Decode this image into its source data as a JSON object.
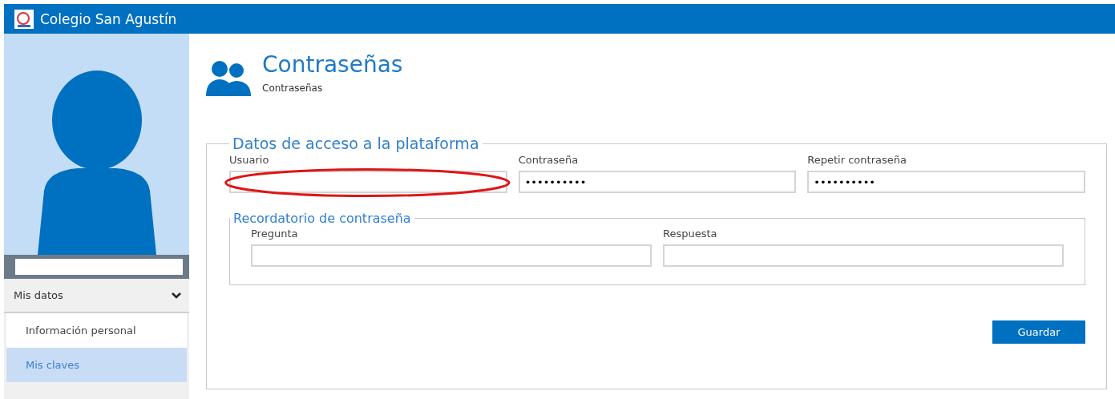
{
  "header": {
    "title": "Colegio San Agustín"
  },
  "sidebar": {
    "menu": {
      "label": "Mis datos",
      "expanded": true
    },
    "items": [
      {
        "label": "Información personal",
        "selected": false
      },
      {
        "label": "Mis claves",
        "selected": true
      }
    ]
  },
  "page": {
    "title": "Contraseñas",
    "subtitle": "Contraseñas"
  },
  "access": {
    "legend": "Datos de acceso a la plataforma",
    "fields": [
      {
        "label": "Usuario",
        "highlighted": true
      },
      {
        "label": "Contraseña",
        "value": "••••••••••"
      },
      {
        "label": "Repetir contraseña",
        "value": "••••••••••"
      }
    ]
  },
  "reminder": {
    "legend": "Recordatorio de contraseña",
    "fields": [
      {
        "label": "Pregunta"
      },
      {
        "label": "Respuesta"
      }
    ]
  },
  "buttons": [
    "Guardar"
  ]
}
